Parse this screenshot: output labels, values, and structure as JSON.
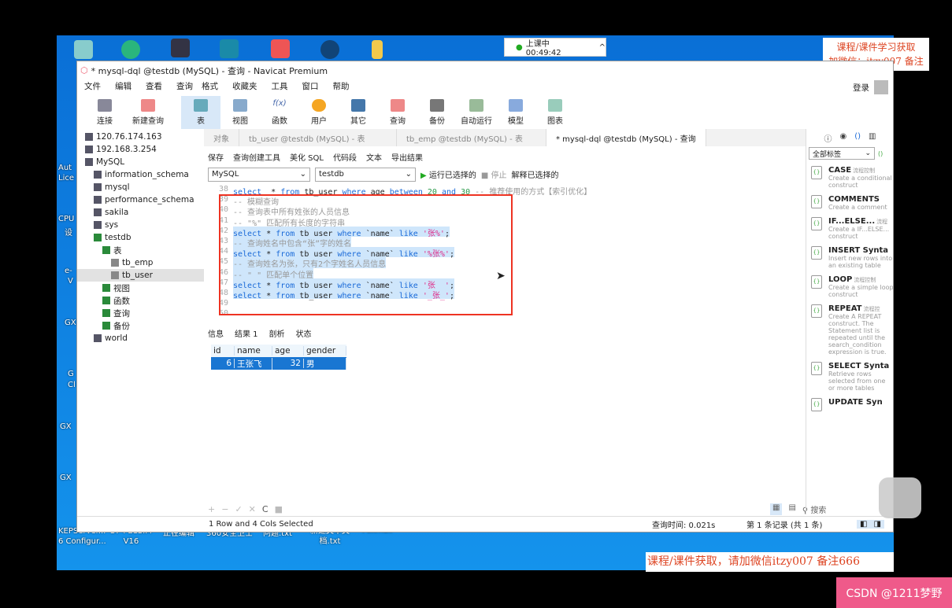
{
  "desktop": {
    "clock": "上课中 00:49:42",
    "left_labels": [
      "Aut",
      "Lice",
      "CPU",
      "设",
      "e-",
      "V",
      "GX",
      "G",
      "Cl",
      "GX",
      "GX"
    ],
    "bottom_labels": [
      [
        "KEPServer...",
        "6 Configur..."
      ],
      [
        "S7-PLCSIM",
        "V16"
      ],
      [
        "正在编辑",
        ""
      ],
      [
        "360安全卫士",
        ""
      ],
      [
        "问题.txt",
        ""
      ],
      [
        "新建文本文",
        "档.txt"
      ],
      [
        "Foxmail",
        ""
      ]
    ]
  },
  "watermark_top": [
    "课程/课件学习获取",
    "加微信：itzy007 备注666"
  ],
  "watermark_bottom": "课程/课件获取，请加微信itzy007 备注666",
  "csdn_button": "CSDN @1211梦野",
  "window": {
    "title": "* mysql-dql @testdb (MySQL) - 查询 - Navicat Premium",
    "login": "登录"
  },
  "menu": [
    "文件",
    "编辑",
    "查看",
    "查询",
    "格式",
    "收藏夹",
    "工具",
    "窗口",
    "帮助"
  ],
  "toolbar": [
    "连接",
    "新建查询",
    "表",
    "视图",
    "函数",
    "用户",
    "其它",
    "查询",
    "备份",
    "自动运行",
    "模型",
    "图表"
  ],
  "tree": {
    "items": [
      {
        "label": "120.76.174.163",
        "level": 0
      },
      {
        "label": "192.168.3.254",
        "level": 0
      },
      {
        "label": "MySQL",
        "level": 0
      },
      {
        "label": "information_schema",
        "level": 1
      },
      {
        "label": "mysql",
        "level": 1
      },
      {
        "label": "performance_schema",
        "level": 1
      },
      {
        "label": "sakila",
        "level": 1
      },
      {
        "label": "sys",
        "level": 1
      },
      {
        "label": "testdb",
        "level": 1
      },
      {
        "label": "表",
        "level": 2
      },
      {
        "label": "tb_emp",
        "level": 3
      },
      {
        "label": "tb_user",
        "level": 3,
        "selected": true
      },
      {
        "label": "视图",
        "level": 2
      },
      {
        "label": "函数",
        "level": 2
      },
      {
        "label": "查询",
        "level": 2
      },
      {
        "label": "备份",
        "level": 2
      },
      {
        "label": "world",
        "level": 1
      }
    ]
  },
  "tabs": [
    "对象",
    "tb_user @testdb (MySQL) - 表",
    "tb_emp @testdb (MySQL) - 表",
    "* mysql-dql @testdb (MySQL) - 查询"
  ],
  "editor_toolbar": [
    "保存",
    "查询创建工具",
    "美化 SQL",
    "代码段",
    "文本",
    "导出结果"
  ],
  "connection": "MySQL",
  "database": "testdb",
  "run_actions": [
    "运行已选择的",
    "停止",
    "解释已选择的"
  ],
  "code": [
    {
      "n": "38",
      "t": [
        [
          "kw",
          "select"
        ],
        [
          "",
          "  * "
        ],
        [
          "kw",
          "from"
        ],
        [
          "",
          " tb_user "
        ],
        [
          "kw",
          "where"
        ],
        [
          "",
          " age "
        ],
        [
          "kw",
          "between"
        ],
        [
          "",
          " "
        ],
        [
          "nu",
          "20"
        ],
        [
          "",
          " "
        ],
        [
          "kw",
          "and"
        ],
        [
          "",
          " "
        ],
        [
          "nu",
          "30"
        ],
        [
          "cm",
          " -- 推荐使用的方式【索引优化】"
        ]
      ]
    },
    {
      "n": "39",
      "t": [
        [
          "cm",
          "-- 模糊查询"
        ]
      ]
    },
    {
      "n": "40",
      "t": [
        [
          "cm",
          "-- 查询表中所有姓张的人员信息"
        ]
      ]
    },
    {
      "n": "41",
      "t": [
        [
          "cm",
          "-- \"%\" 匹配所有长度的字符串"
        ]
      ]
    },
    {
      "n": "42",
      "hl": true,
      "t": [
        [
          "kw",
          "select"
        ],
        [
          "",
          " * "
        ],
        [
          "kw",
          "from"
        ],
        [
          "",
          " tb_user "
        ],
        [
          "kw",
          "where"
        ],
        [
          "",
          " `name` "
        ],
        [
          "kw",
          "like"
        ],
        [
          "",
          " "
        ],
        [
          "st",
          "'张%'"
        ],
        [
          "",
          ";"
        ]
      ]
    },
    {
      "n": "43",
      "hl": true,
      "t": [
        [
          "cm",
          "-- 查询姓名中包含“张”字的姓名"
        ]
      ]
    },
    {
      "n": "44",
      "hl": true,
      "t": [
        [
          "kw",
          "select"
        ],
        [
          "",
          " * "
        ],
        [
          "kw",
          "from"
        ],
        [
          "",
          " tb_user "
        ],
        [
          "kw",
          "where"
        ],
        [
          "",
          " `name` "
        ],
        [
          "kw",
          "like"
        ],
        [
          "",
          " "
        ],
        [
          "st",
          "'%张%'"
        ],
        [
          "",
          ";"
        ]
      ]
    },
    {
      "n": "45",
      "hl": true,
      "t": [
        [
          "cm",
          "-- 查询姓名为张，只有2个字姓名人员信息"
        ]
      ]
    },
    {
      "n": "46",
      "hl": true,
      "t": [
        [
          "cm",
          "-- \"_\" 匹配单个位置"
        ]
      ]
    },
    {
      "n": "47",
      "hl": true,
      "t": [
        [
          "kw",
          "select"
        ],
        [
          "",
          " * "
        ],
        [
          "kw",
          "from"
        ],
        [
          "",
          " tb_user "
        ],
        [
          "kw",
          "where"
        ],
        [
          "",
          " `name` "
        ],
        [
          "kw",
          "like"
        ],
        [
          "",
          " "
        ],
        [
          "st",
          "'张__'"
        ],
        [
          "",
          ";"
        ]
      ]
    },
    {
      "n": "48",
      "hl": true,
      "t": [
        [
          "kw",
          "select"
        ],
        [
          "",
          " * "
        ],
        [
          "kw",
          "from"
        ],
        [
          "",
          " tb_user "
        ],
        [
          "kw",
          "where"
        ],
        [
          "",
          " `name` "
        ],
        [
          "kw",
          "like"
        ],
        [
          "",
          " "
        ],
        [
          "st",
          "'_张_'"
        ],
        [
          "",
          ";"
        ]
      ]
    },
    {
      "n": "49",
      "t": []
    },
    {
      "n": "50",
      "t": []
    }
  ],
  "result_tabs": [
    "信息",
    "结果 1",
    "剖析",
    "状态"
  ],
  "grid": {
    "columns": [
      "id",
      "name",
      "age",
      "gender"
    ],
    "rows": [
      [
        "6",
        "王张飞",
        "32",
        "男"
      ]
    ]
  },
  "status": {
    "selection": "1 Row and 4 Cols Selected",
    "query_time": "查询时间: 0.021s",
    "record": "第 1 条记录 (共 1 条)"
  },
  "right_panel": {
    "filter": "全部标签",
    "search": "搜索",
    "snippets": [
      {
        "title": "CASE",
        "tag": "流程控制",
        "desc": "Create a conditional construct"
      },
      {
        "title": "COMMENTS",
        "tag": "",
        "desc": "Create a comment"
      },
      {
        "title": "IF...ELSE...",
        "tag": "流程",
        "desc": "Create a IF...ELSE... construct"
      },
      {
        "title": "INSERT Synta",
        "tag": "",
        "desc": "Insert new rows into an existing table"
      },
      {
        "title": "LOOP",
        "tag": "流程控制",
        "desc": "Create a simple loop construct"
      },
      {
        "title": "REPEAT",
        "tag": "流程控",
        "desc": "Create A REPEAT construct. The Statement list is repeated until the search_condition expression is true."
      },
      {
        "title": "SELECT Synta",
        "tag": "",
        "desc": "Retrieve rows selected from one or more tables"
      },
      {
        "title": "UPDATE Syn",
        "tag": "",
        "desc": ""
      }
    ]
  }
}
